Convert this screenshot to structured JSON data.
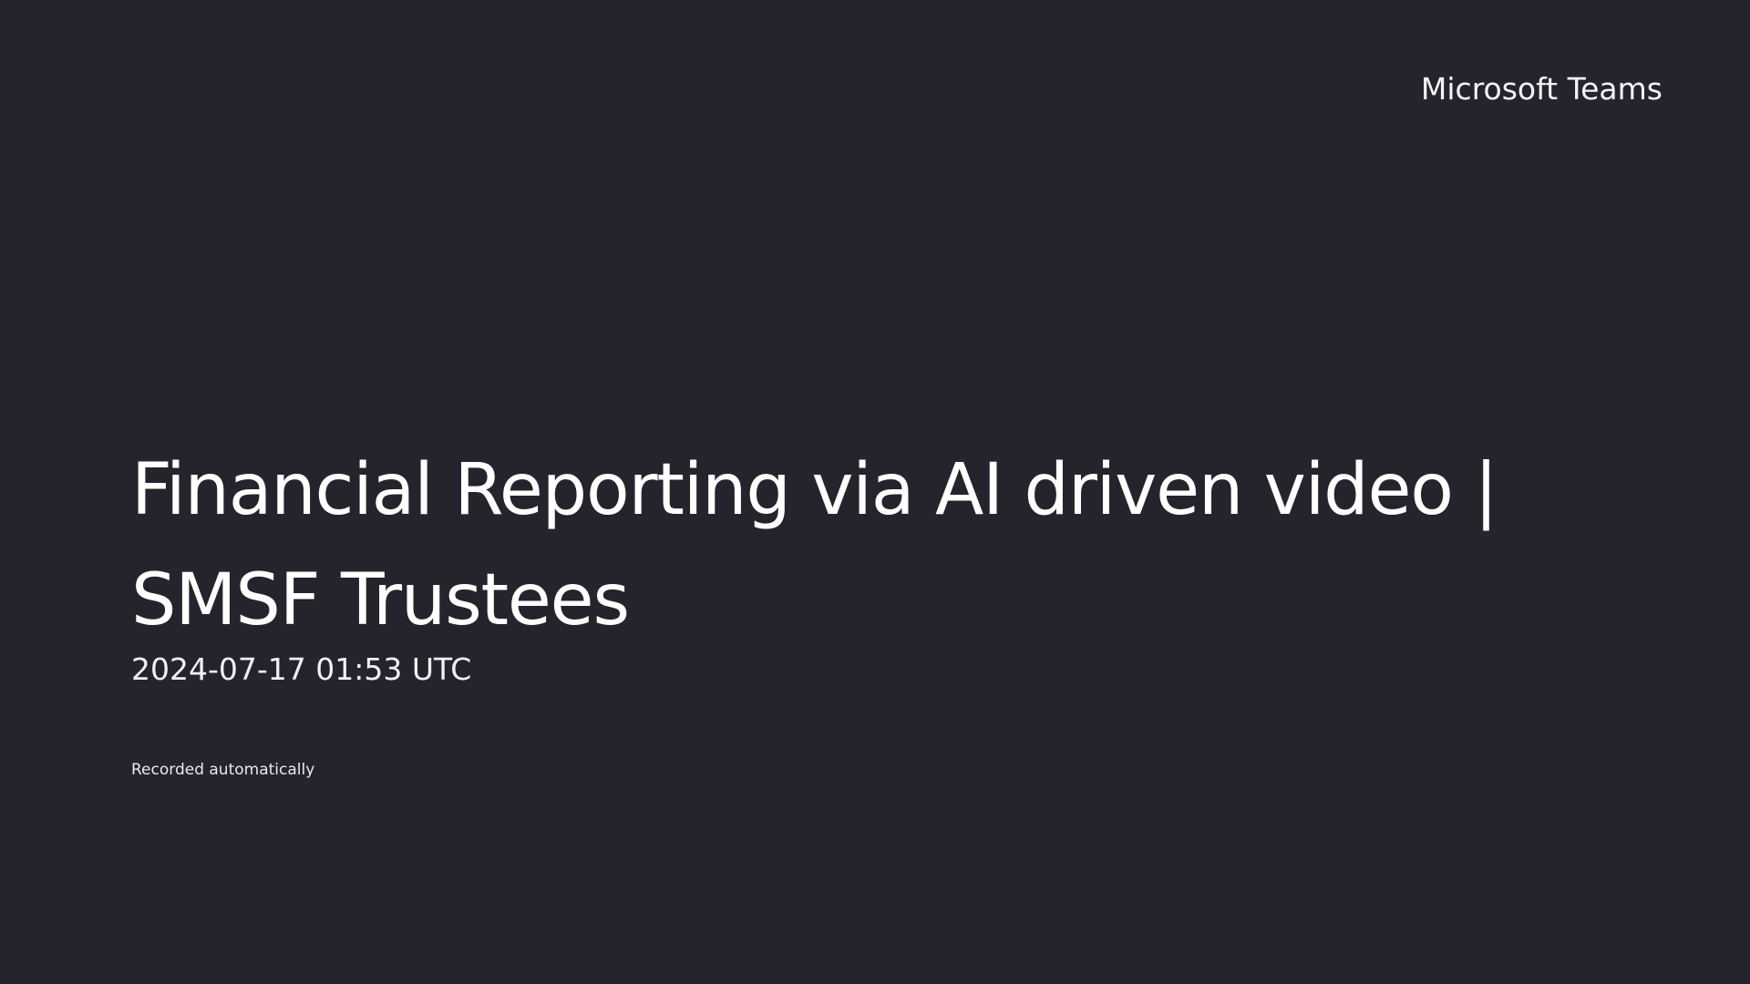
{
  "screen": {
    "background_color": "#25242d",
    "text_color": "#ffffff"
  },
  "brand": {
    "label": "Microsoft Teams"
  },
  "meeting": {
    "title": "Financial Reporting via AI driven video | SMSF Trustees",
    "timestamp": "2024-07-17 01:53 UTC",
    "recording_note": "Recorded automatically"
  }
}
